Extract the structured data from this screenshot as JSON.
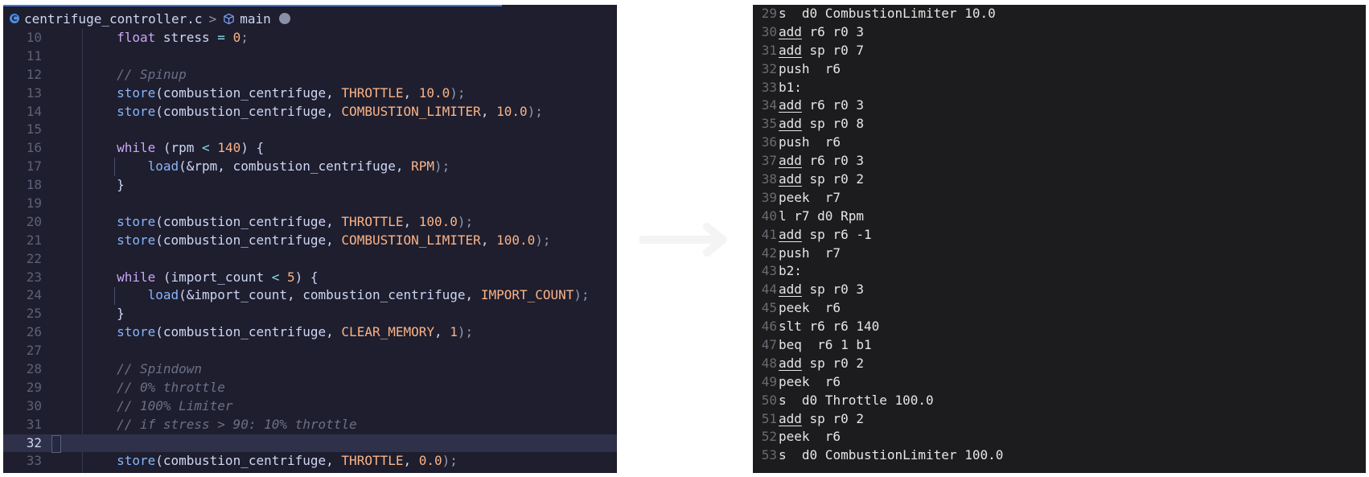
{
  "editor": {
    "breadcrumb": {
      "file": "centrifuge_controller.c",
      "separator": ">",
      "symbol": "main",
      "file_icon_letter": "C"
    },
    "current_line": 32,
    "lines": [
      {
        "n": "10",
        "tokens": [
          [
            "        ",
            ""
          ],
          [
            "float",
            "kw"
          ],
          [
            " stress ",
            ""
          ],
          [
            "=",
            "op"
          ],
          [
            " ",
            ""
          ],
          [
            "0",
            "nm"
          ],
          [
            ";",
            "pu"
          ]
        ]
      },
      {
        "n": "11",
        "tokens": []
      },
      {
        "n": "12",
        "tokens": [
          [
            "        ",
            ""
          ],
          [
            "// Spinup",
            "cm"
          ]
        ]
      },
      {
        "n": "13",
        "tokens": [
          [
            "        ",
            ""
          ],
          [
            "store",
            "fn"
          ],
          [
            "(combustion_centrifuge, ",
            ""
          ],
          [
            "THROTTLE",
            "cn"
          ],
          [
            ", ",
            ""
          ],
          [
            "10.0",
            "nm"
          ],
          [
            ");",
            "pu"
          ]
        ]
      },
      {
        "n": "14",
        "tokens": [
          [
            "        ",
            ""
          ],
          [
            "store",
            "fn"
          ],
          [
            "(combustion_centrifuge, ",
            ""
          ],
          [
            "COMBUSTION_LIMITER",
            "cn"
          ],
          [
            ", ",
            ""
          ],
          [
            "10.0",
            "nm"
          ],
          [
            ");",
            "pu"
          ]
        ]
      },
      {
        "n": "15",
        "tokens": []
      },
      {
        "n": "16",
        "tokens": [
          [
            "        ",
            ""
          ],
          [
            "while",
            "kw"
          ],
          [
            " (rpm ",
            ""
          ],
          [
            "<",
            "op"
          ],
          [
            " ",
            ""
          ],
          [
            "140",
            "nm"
          ],
          [
            ") {",
            ""
          ]
        ]
      },
      {
        "n": "17",
        "tokens": [
          [
            "            ",
            ""
          ],
          [
            "load",
            "fn"
          ],
          [
            "(&rpm, combustion_centrifuge, ",
            ""
          ],
          [
            "RPM",
            "cn"
          ],
          [
            ");",
            "pu"
          ]
        ]
      },
      {
        "n": "18",
        "tokens": [
          [
            "        ",
            ""
          ],
          [
            "}",
            ""
          ]
        ]
      },
      {
        "n": "19",
        "tokens": []
      },
      {
        "n": "20",
        "tokens": [
          [
            "        ",
            ""
          ],
          [
            "store",
            "fn"
          ],
          [
            "(combustion_centrifuge, ",
            ""
          ],
          [
            "THROTTLE",
            "cn"
          ],
          [
            ", ",
            ""
          ],
          [
            "100.0",
            "nm"
          ],
          [
            ");",
            "pu"
          ]
        ]
      },
      {
        "n": "21",
        "tokens": [
          [
            "        ",
            ""
          ],
          [
            "store",
            "fn"
          ],
          [
            "(combustion_centrifuge, ",
            ""
          ],
          [
            "COMBUSTION_LIMITER",
            "cn"
          ],
          [
            ", ",
            ""
          ],
          [
            "100.0",
            "nm"
          ],
          [
            ");",
            "pu"
          ]
        ]
      },
      {
        "n": "22",
        "tokens": []
      },
      {
        "n": "23",
        "tokens": [
          [
            "        ",
            ""
          ],
          [
            "while",
            "kw"
          ],
          [
            " (import_count ",
            ""
          ],
          [
            "<",
            "op"
          ],
          [
            " ",
            ""
          ],
          [
            "5",
            "nm"
          ],
          [
            ") {",
            ""
          ]
        ]
      },
      {
        "n": "24",
        "tokens": [
          [
            "            ",
            ""
          ],
          [
            "load",
            "fn"
          ],
          [
            "(&import_count, combustion_centrifuge, ",
            ""
          ],
          [
            "IMPORT_COUNT",
            "cn"
          ],
          [
            ");",
            "pu"
          ]
        ]
      },
      {
        "n": "25",
        "tokens": [
          [
            "        ",
            ""
          ],
          [
            "}",
            ""
          ]
        ]
      },
      {
        "n": "26",
        "tokens": [
          [
            "        ",
            ""
          ],
          [
            "store",
            "fn"
          ],
          [
            "(combustion_centrifuge, ",
            ""
          ],
          [
            "CLEAR_MEMORY",
            "cn"
          ],
          [
            ", ",
            ""
          ],
          [
            "1",
            "nm"
          ],
          [
            ");",
            "pu"
          ]
        ]
      },
      {
        "n": "27",
        "tokens": []
      },
      {
        "n": "28",
        "tokens": [
          [
            "        ",
            ""
          ],
          [
            "// Spindown",
            "cm"
          ]
        ]
      },
      {
        "n": "29",
        "tokens": [
          [
            "        ",
            ""
          ],
          [
            "// 0% throttle",
            "cm"
          ]
        ]
      },
      {
        "n": "30",
        "tokens": [
          [
            "        ",
            ""
          ],
          [
            "// 100% Limiter",
            "cm"
          ]
        ]
      },
      {
        "n": "31",
        "tokens": [
          [
            "        ",
            ""
          ],
          [
            "// if stress > 90: 10% throttle",
            "cm"
          ]
        ]
      },
      {
        "n": "32",
        "tokens": []
      },
      {
        "n": "33",
        "tokens": [
          [
            "        ",
            ""
          ],
          [
            "store",
            "fn"
          ],
          [
            "(combustion_centrifuge, ",
            ""
          ],
          [
            "THROTTLE",
            "cn"
          ],
          [
            ", ",
            ""
          ],
          [
            "0.0",
            "nm"
          ],
          [
            ");",
            "pu"
          ]
        ]
      }
    ]
  },
  "assembly": {
    "lines": [
      {
        "n": "29",
        "op": "s",
        "rest": "  d0 CombustionLimiter 10.0",
        "u": false
      },
      {
        "n": "30",
        "op": "add",
        "rest": " r6 r0 3",
        "u": true
      },
      {
        "n": "31",
        "op": "add",
        "rest": " sp r0 7",
        "u": true
      },
      {
        "n": "32",
        "op": "push",
        "rest": "  r6",
        "u": false
      },
      {
        "n": "33",
        "op": "b1:",
        "rest": "",
        "u": false
      },
      {
        "n": "34",
        "op": "add",
        "rest": " r6 r0 3",
        "u": true
      },
      {
        "n": "35",
        "op": "add",
        "rest": " sp r0 8",
        "u": true
      },
      {
        "n": "36",
        "op": "push",
        "rest": "  r6",
        "u": false
      },
      {
        "n": "37",
        "op": "add",
        "rest": " r6 r0 3",
        "u": true
      },
      {
        "n": "38",
        "op": "add",
        "rest": " sp r0 2",
        "u": true
      },
      {
        "n": "39",
        "op": "peek",
        "rest": "  r7",
        "u": false
      },
      {
        "n": "40",
        "op": "l",
        "rest": " r7 d0 Rpm",
        "u": false
      },
      {
        "n": "41",
        "op": "add",
        "rest": " sp r6 -1",
        "u": true
      },
      {
        "n": "42",
        "op": "push",
        "rest": "  r7",
        "u": false
      },
      {
        "n": "43",
        "op": "b2:",
        "rest": "",
        "u": false
      },
      {
        "n": "44",
        "op": "add",
        "rest": " sp r0 3",
        "u": true
      },
      {
        "n": "45",
        "op": "peek",
        "rest": "  r6",
        "u": false
      },
      {
        "n": "46",
        "op": "slt",
        "rest": " r6 r6 140",
        "u": false
      },
      {
        "n": "47",
        "op": "beq",
        "rest": "  r6 1 b1",
        "u": false
      },
      {
        "n": "48",
        "op": "add",
        "rest": " sp r0 2",
        "u": true
      },
      {
        "n": "49",
        "op": "peek",
        "rest": "  r6",
        "u": false
      },
      {
        "n": "50",
        "op": "s",
        "rest": "  d0 Throttle 100.0",
        "u": false
      },
      {
        "n": "51",
        "op": "add",
        "rest": " sp r0 2",
        "u": true
      },
      {
        "n": "52",
        "op": "peek",
        "rest": "  r6",
        "u": false
      },
      {
        "n": "53",
        "op": "s",
        "rest": "  d0 CombustionLimiter 100.0",
        "u": false
      }
    ]
  },
  "colors": {
    "editor_bg": "#1e1e2e",
    "asm_bg": "#1c1c1e",
    "accent": "#3a7be0",
    "keyword": "#cba6f7",
    "function": "#89b4fa",
    "constant": "#fab387",
    "comment": "#6c7086"
  }
}
